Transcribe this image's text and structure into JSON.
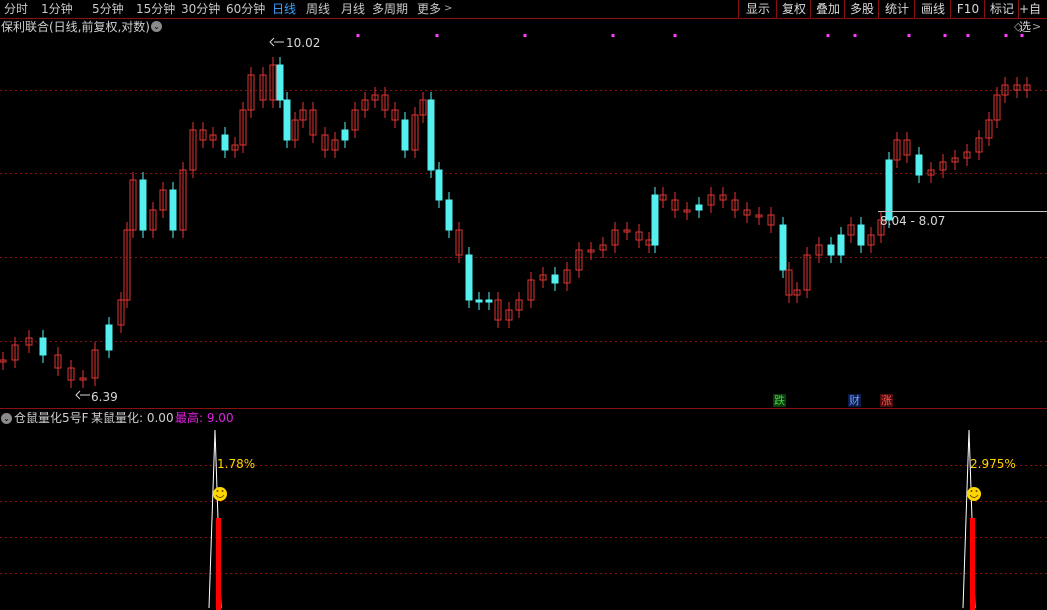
{
  "toolbar": {
    "tabs": [
      "分时",
      "1分钟",
      "5分钟",
      "15分钟",
      "30分钟",
      "60分钟",
      "日线",
      "周线",
      "月线",
      "多周期",
      "更多"
    ],
    "active_tab": "日线",
    "more_icon": "chevron-right-icon",
    "buttons": [
      "显示",
      "复权",
      "叠加",
      "多股",
      "统计",
      "画线",
      "F10",
      "标记",
      "+自选"
    ]
  },
  "main_panel": {
    "title": "保利联合(日线,前复权,对数)",
    "dropdown_icon": "chevron-down-icon",
    "high_label": "10.02",
    "low_label": "6.39",
    "range_label": "8.04 - 8.07",
    "signals": [
      {
        "text": "跌",
        "color": "#3dd13d"
      },
      {
        "text": "财",
        "color": "#4a7cff"
      },
      {
        "text": "涨",
        "color": "#ff4040"
      }
    ],
    "colors": {
      "up": "#e03535",
      "down": "#54f0f0",
      "grid": "#8a1010",
      "event_marker": "#ff3cff"
    }
  },
  "indicator_panel": {
    "title": "仓鼠量化5号F",
    "series_label": "某鼠量化: 0.00",
    "max_label": "最高: 9.00",
    "annotations": [
      "1.78%",
      "2.975%"
    ],
    "smile_icon": "smiley-face-icon",
    "colors": {
      "bar": "#ff0000",
      "spike": "#ffffff",
      "label": "#ffd700",
      "max": "#e020e0"
    }
  },
  "chart_data": {
    "type": "candlestick",
    "value_range": [
      6.2,
      10.4
    ],
    "extremes": {
      "high": 10.02,
      "low": 6.39
    },
    "range_marker": [
      8.04,
      8.07
    ],
    "indicator": {
      "name": "某鼠量化",
      "current": 0.0,
      "max": 9.0,
      "annotations": [
        1.78,
        2.975
      ]
    }
  }
}
